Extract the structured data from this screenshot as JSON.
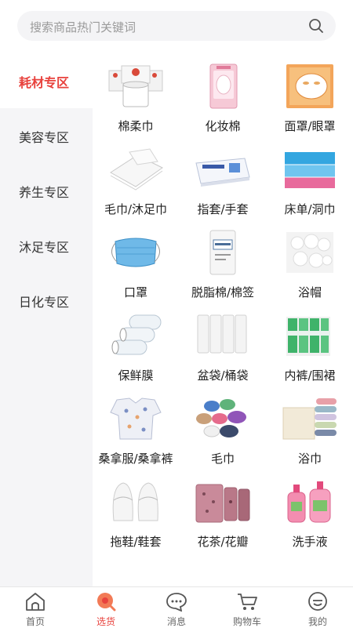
{
  "search": {
    "placeholder": "搜索商品热门关键词",
    "icon": "search-icon"
  },
  "sidebar": {
    "items": [
      {
        "label": "耗材专区",
        "active": true
      },
      {
        "label": "美容专区",
        "active": false
      },
      {
        "label": "养生专区",
        "active": false
      },
      {
        "label": "沐足专区",
        "active": false
      },
      {
        "label": "日化专区",
        "active": false
      }
    ]
  },
  "products": [
    {
      "label": "棉柔巾",
      "icon": "tissue-roll-image"
    },
    {
      "label": "化妆棉",
      "icon": "cotton-pad-image"
    },
    {
      "label": "面罩/眼罩",
      "icon": "face-mask-sheet-image"
    },
    {
      "label": "毛巾/沐足巾",
      "icon": "towel-image"
    },
    {
      "label": "指套/手套",
      "icon": "glove-box-image"
    },
    {
      "label": "床单/洞巾",
      "icon": "bed-sheet-image"
    },
    {
      "label": "口罩",
      "icon": "surgical-mask-image"
    },
    {
      "label": "脱脂棉/棉签",
      "icon": "cotton-bag-image"
    },
    {
      "label": "浴帽",
      "icon": "shower-cap-image"
    },
    {
      "label": "保鲜膜",
      "icon": "cling-film-image"
    },
    {
      "label": "盆袋/桶袋",
      "icon": "basin-bag-image"
    },
    {
      "label": "内裤/围裙",
      "icon": "underwear-pack-image"
    },
    {
      "label": "桑拿服/桑拿裤",
      "icon": "sauna-suit-image"
    },
    {
      "label": "毛巾",
      "icon": "colored-towels-image"
    },
    {
      "label": "浴巾",
      "icon": "bath-towel-image"
    },
    {
      "label": "拖鞋/鞋套",
      "icon": "slippers-image"
    },
    {
      "label": "花茶/花瓣",
      "icon": "flower-tea-image"
    },
    {
      "label": "洗手液",
      "icon": "hand-soap-image"
    }
  ],
  "tabbar": {
    "tabs": [
      {
        "label": "首页",
        "icon": "home-icon",
        "active": false
      },
      {
        "label": "选货",
        "icon": "search-bubble-icon",
        "active": true
      },
      {
        "label": "消息",
        "icon": "message-icon",
        "active": false
      },
      {
        "label": "购物车",
        "icon": "cart-icon",
        "active": false
      },
      {
        "label": "我的",
        "icon": "profile-icon",
        "active": false
      }
    ]
  },
  "colors": {
    "accent": "#e8423d",
    "sidebar_bg": "#f5f5f7",
    "search_bg": "#f4f4f6"
  }
}
